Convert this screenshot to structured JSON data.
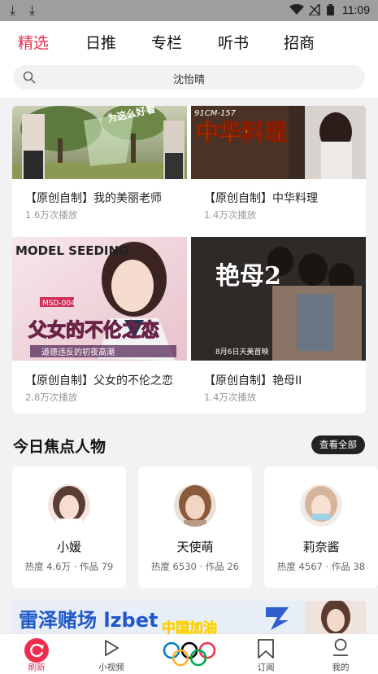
{
  "status_bar": {
    "time": "11:09"
  },
  "tabs": [
    {
      "label": "精选",
      "active": true
    },
    {
      "label": "日推",
      "active": false
    },
    {
      "label": "专栏",
      "active": false
    },
    {
      "label": "听书",
      "active": false
    },
    {
      "label": "招商",
      "active": false
    }
  ],
  "search": {
    "text": "沈怡晴"
  },
  "videos": [
    {
      "title": "【原创自制】我的美丽老师",
      "plays": "1.6万次播放",
      "overlay": "为这么好看"
    },
    {
      "title": "【原创自制】中华料理",
      "plays": "1.4万次播放",
      "overlay": "中华料理",
      "code": "91CM-157"
    },
    {
      "title": "【原创自制】父女的不伦之恋",
      "plays": "2.8万次播放",
      "overlay": "父女的不伦之恋",
      "brand": "MODEL SEEDING",
      "code": "MSD-004",
      "subtitle": "道德违反的初夜高潮"
    },
    {
      "title": "【原创自制】艳母II",
      "plays": "1.4万次播放",
      "overlay": "艳母2",
      "date_note": "8月6日天美首映"
    }
  ],
  "focus": {
    "title": "今日焦点人物",
    "see_all": "查看全部",
    "people": [
      {
        "name": "小媛",
        "stats": "热度 4.6万 · 作品 79"
      },
      {
        "name": "天使萌",
        "stats": "热度 6530 · 作品 26"
      },
      {
        "name": "莉奈酱",
        "stats": "热度 4567 · 作品 38"
      }
    ]
  },
  "banner": {
    "text": "雷泽赌场 lzbet",
    "badge": "中国加油"
  },
  "bottom_nav": [
    {
      "label": "刷新",
      "icon": "refresh-icon",
      "active": true
    },
    {
      "label": "小视频",
      "icon": "play-icon",
      "active": false
    },
    {
      "label": "",
      "icon": "olympic-rings-icon",
      "active": false
    },
    {
      "label": "订阅",
      "icon": "bookmark-icon",
      "active": false
    },
    {
      "label": "我的",
      "icon": "user-icon",
      "active": false
    }
  ],
  "colors": {
    "accent": "#ee2d4f",
    "background": "#f2f2f5",
    "dark": "#222222"
  }
}
